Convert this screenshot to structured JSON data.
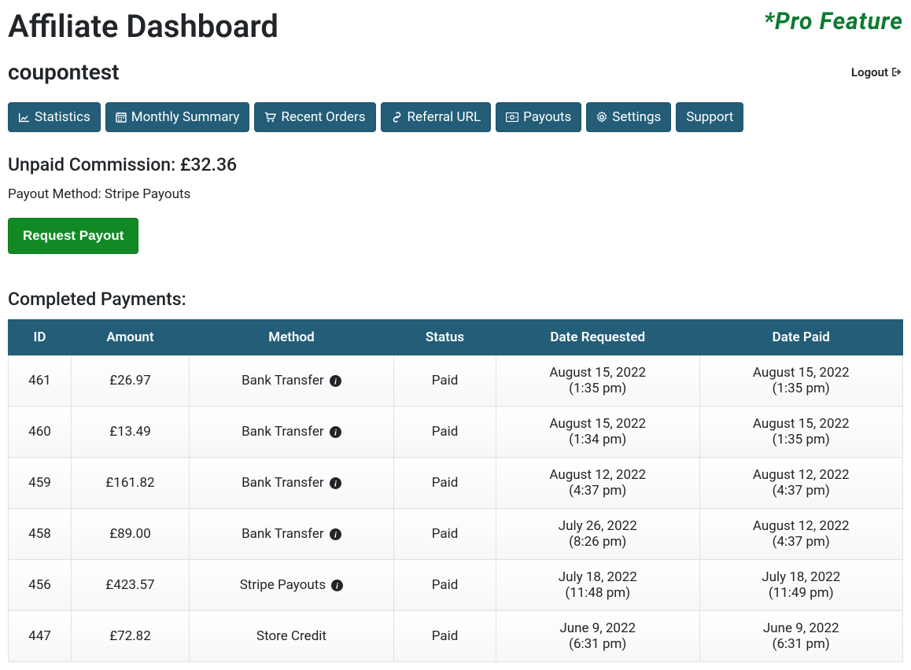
{
  "header": {
    "title": "Affiliate Dashboard",
    "pro_badge": "*Pro Feature"
  },
  "user": {
    "name": "coupontest",
    "logout_label": "Logout"
  },
  "tabs": {
    "statistics": "Statistics",
    "monthly_summary": "Monthly Summary",
    "recent_orders": "Recent Orders",
    "referral_url": "Referral URL",
    "payouts": "Payouts",
    "settings": "Settings",
    "support": "Support"
  },
  "commission": {
    "unpaid_label": "Unpaid Commission: £32.36",
    "payout_method_label": "Payout Method: Stripe Payouts",
    "request_button": "Request Payout"
  },
  "completed": {
    "heading": "Completed Payments:",
    "columns": {
      "id": "ID",
      "amount": "Amount",
      "method": "Method",
      "status": "Status",
      "date_requested": "Date Requested",
      "date_paid": "Date Paid"
    },
    "rows": [
      {
        "id": "461",
        "amount": "£26.97",
        "method": "Bank Transfer",
        "has_info": true,
        "status": "Paid",
        "date_requested": "August 15, 2022",
        "time_requested": "(1:35 pm)",
        "date_paid": "August 15, 2022",
        "time_paid": "(1:35 pm)"
      },
      {
        "id": "460",
        "amount": "£13.49",
        "method": "Bank Transfer",
        "has_info": true,
        "status": "Paid",
        "date_requested": "August 15, 2022",
        "time_requested": "(1:34 pm)",
        "date_paid": "August 15, 2022",
        "time_paid": "(1:35 pm)"
      },
      {
        "id": "459",
        "amount": "£161.82",
        "method": "Bank Transfer",
        "has_info": true,
        "status": "Paid",
        "date_requested": "August 12, 2022",
        "time_requested": "(4:37 pm)",
        "date_paid": "August 12, 2022",
        "time_paid": "(4:37 pm)"
      },
      {
        "id": "458",
        "amount": "£89.00",
        "method": "Bank Transfer",
        "has_info": true,
        "status": "Paid",
        "date_requested": "July 26, 2022",
        "time_requested": "(8:26 pm)",
        "date_paid": "August 12, 2022",
        "time_paid": "(4:37 pm)"
      },
      {
        "id": "456",
        "amount": "£423.57",
        "method": "Stripe Payouts",
        "has_info": true,
        "status": "Paid",
        "date_requested": "July 18, 2022",
        "time_requested": "(11:48 pm)",
        "date_paid": "July 18, 2022",
        "time_paid": "(11:49 pm)"
      },
      {
        "id": "447",
        "amount": "£72.82",
        "method": "Store Credit",
        "has_info": false,
        "status": "Paid",
        "date_requested": "June 9, 2022",
        "time_requested": "(6:31 pm)",
        "date_paid": "June 9, 2022",
        "time_paid": "(6:31 pm)"
      }
    ]
  }
}
